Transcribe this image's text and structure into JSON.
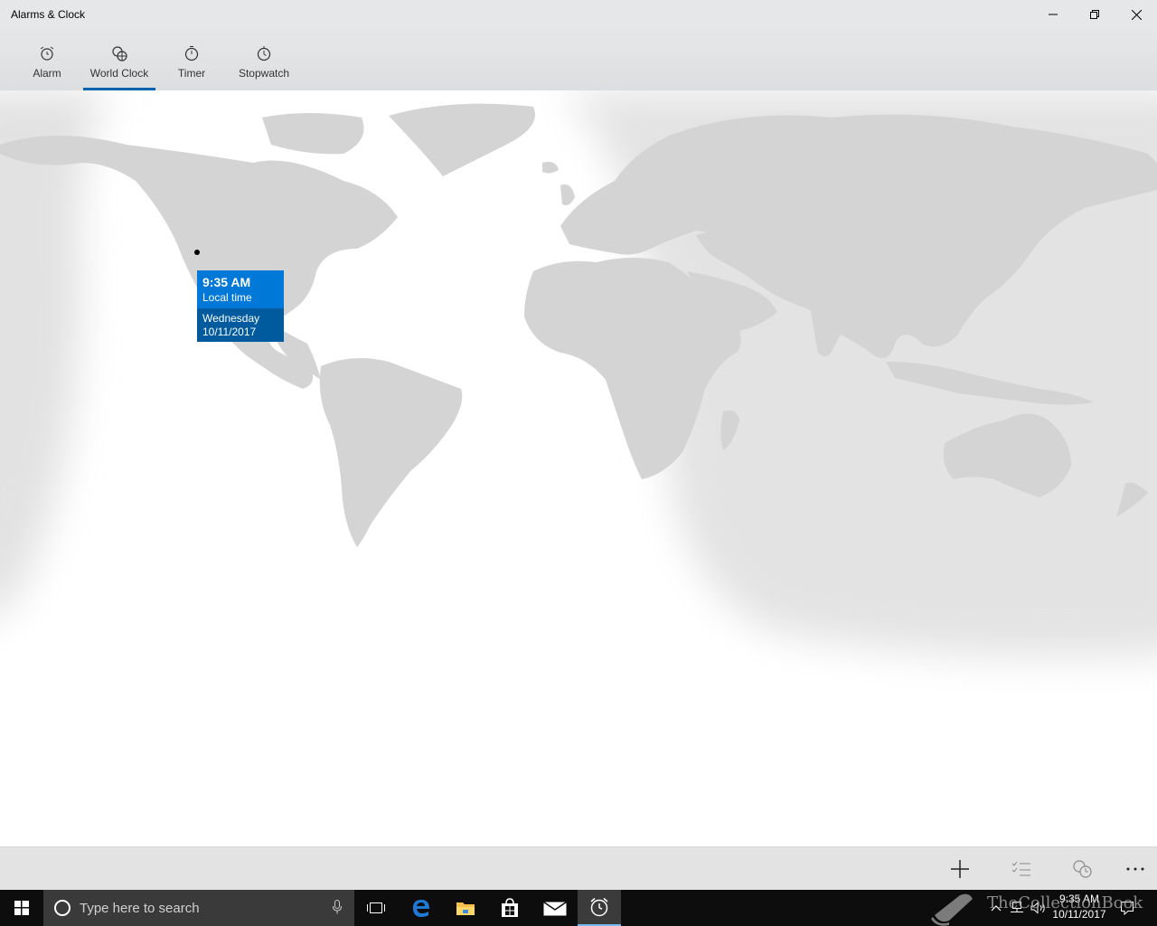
{
  "window": {
    "title": "Alarms & Clock"
  },
  "tabs": [
    {
      "label": "Alarm",
      "icon": "alarm-clock-icon"
    },
    {
      "label": "World Clock",
      "icon": "world-clock-icon",
      "active": true
    },
    {
      "label": "Timer",
      "icon": "timer-icon"
    },
    {
      "label": "Stopwatch",
      "icon": "stopwatch-icon"
    }
  ],
  "tooltip": {
    "time": "9:35 AM",
    "subtitle": "Local time",
    "day": "Wednesday",
    "date": "10/11/2017"
  },
  "commands": [
    "add-icon",
    "select-icon",
    "compare-icon",
    "more-icon"
  ],
  "taskbar": {
    "search_placeholder": "Type here to search",
    "clock_time": "9:35 AM",
    "clock_date": "10/11/2017",
    "apps": [
      "task-view-icon",
      "edge-icon",
      "file-explorer-icon",
      "store-icon",
      "mail-icon",
      "alarms-icon"
    ]
  },
  "watermark": {
    "text": "TheCollectionBook"
  },
  "colors": {
    "accent": "#0078d7",
    "accent_dark": "#005a9e",
    "land": "#d6d6d6",
    "night": "#e6e6e6",
    "taskbar": "#0d0d0d"
  }
}
